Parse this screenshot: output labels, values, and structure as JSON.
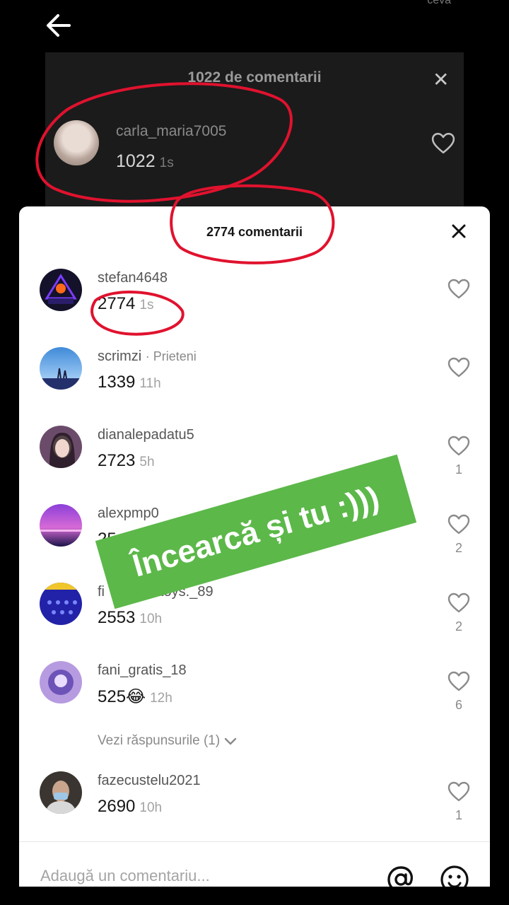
{
  "top_fragment": "ceva",
  "background_panel": {
    "title": "1022 de comentarii",
    "close_icon": "close-icon",
    "comment": {
      "username": "carla_maria7005",
      "text": "1022",
      "time": "1s"
    }
  },
  "sheet": {
    "title": "2774 comentarii",
    "comments": [
      {
        "username": "stefan4648",
        "tag": "",
        "text": "2774",
        "time": "1s",
        "likes": ""
      },
      {
        "username": "scrimzi",
        "tag": "· Prieteni",
        "text": "1339",
        "time": "11h",
        "likes": ""
      },
      {
        "username": "dianalepadatu5",
        "tag": "",
        "text": "2723",
        "time": "5h",
        "likes": "1"
      },
      {
        "username": "alexpmp0",
        "tag": "",
        "text": "25",
        "time": "",
        "likes": "2"
      },
      {
        "username": "fi",
        "tag": "",
        "text": "2553",
        "time": "10h",
        "likes": "2"
      },
      {
        "username": "fani_gratis_18",
        "tag": "",
        "text": "525😂",
        "time": "12h",
        "likes": "6"
      },
      {
        "username": "fazecustelu2021",
        "tag": "",
        "text": "2690",
        "time": "10h",
        "likes": "1"
      }
    ],
    "comment_partial_username_suffix": "toys._89",
    "view_replies": "Vezi răspunsurile (1)",
    "input_placeholder": "Adaugă un comentariu..."
  },
  "sticker_text": "Încearcă și tu :)))",
  "colors": {
    "sticker": "#5cb849",
    "scribble": "#e0122e"
  }
}
